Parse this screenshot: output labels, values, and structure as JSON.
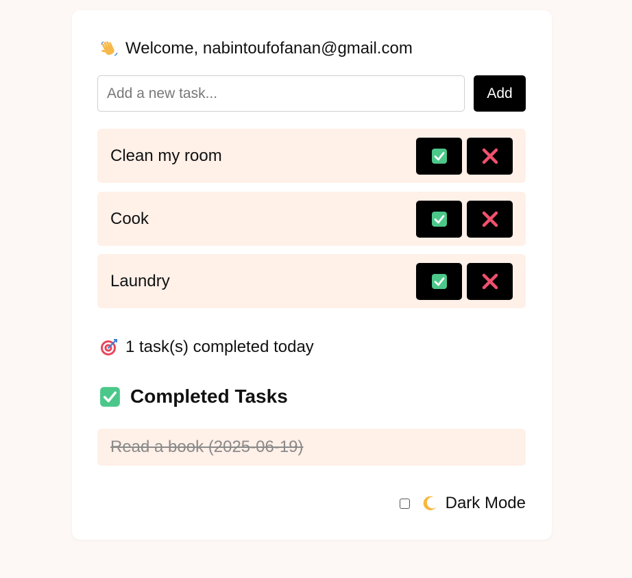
{
  "header": {
    "welcome_text": "Welcome, nabintoufofanan@gmail.com",
    "welcome_icon": "waving-hand-icon"
  },
  "new_task": {
    "placeholder": "Add a new task...",
    "value": "",
    "add_label": "Add"
  },
  "tasks": [
    {
      "label": "Clean my room"
    },
    {
      "label": "Cook"
    },
    {
      "label": "Laundry"
    }
  ],
  "task_actions": {
    "done_icon": "check-mark-icon",
    "delete_icon": "cross-mark-icon"
  },
  "stats": {
    "icon": "target-icon",
    "text": "1 task(s) completed today"
  },
  "completed": {
    "heading_icon": "check-mark-icon",
    "heading": "Completed Tasks",
    "items": [
      {
        "label": "Read a book (2025-06-19)"
      }
    ]
  },
  "settings": {
    "dark_mode_label": "Dark Mode",
    "dark_mode_icon": "crescent-moon-icon",
    "dark_mode_checked": false
  },
  "colors": {
    "page_background": "#fdf8f5",
    "card_background": "#ffffff",
    "task_background": "#fff0e8",
    "button_background": "#000000",
    "check_green": "#4cc78a",
    "cross_red": "#f0506e"
  }
}
